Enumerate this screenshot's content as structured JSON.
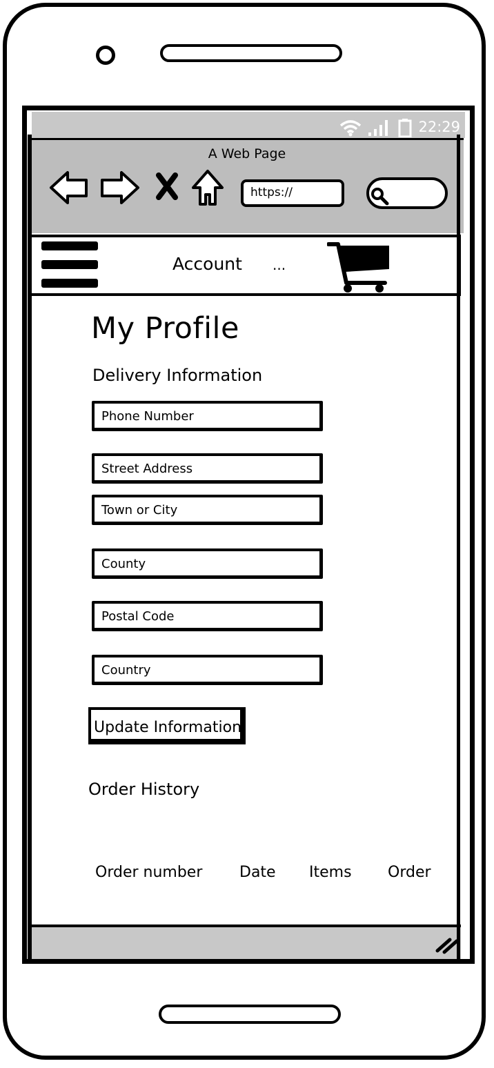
{
  "status_bar": {
    "time": "22:29",
    "icons": [
      "wifi-icon",
      "signal-icon",
      "battery-icon"
    ]
  },
  "browser": {
    "title": "A Web Page",
    "url_value": "https://",
    "icons": [
      "back-icon",
      "forward-icon",
      "stop-icon",
      "home-icon",
      "search-icon"
    ]
  },
  "header": {
    "title": "Account",
    "more": "...",
    "icons": [
      "menu-icon",
      "cart-icon"
    ]
  },
  "page": {
    "title": "My Profile",
    "delivery_heading": "Delivery Information",
    "fields": {
      "phone": "Phone Number",
      "street": "Street Address",
      "town": "Town or City",
      "county": "County",
      "postal": "Postal Code",
      "country": "Country"
    },
    "update_button": "Update Information",
    "order_heading": "Order History",
    "order_columns": [
      "Order number",
      "Date",
      "Items",
      "Order"
    ]
  },
  "colors": {
    "bar_gray": "#c8c8c8",
    "browser_gray": "#bdbdbd"
  }
}
